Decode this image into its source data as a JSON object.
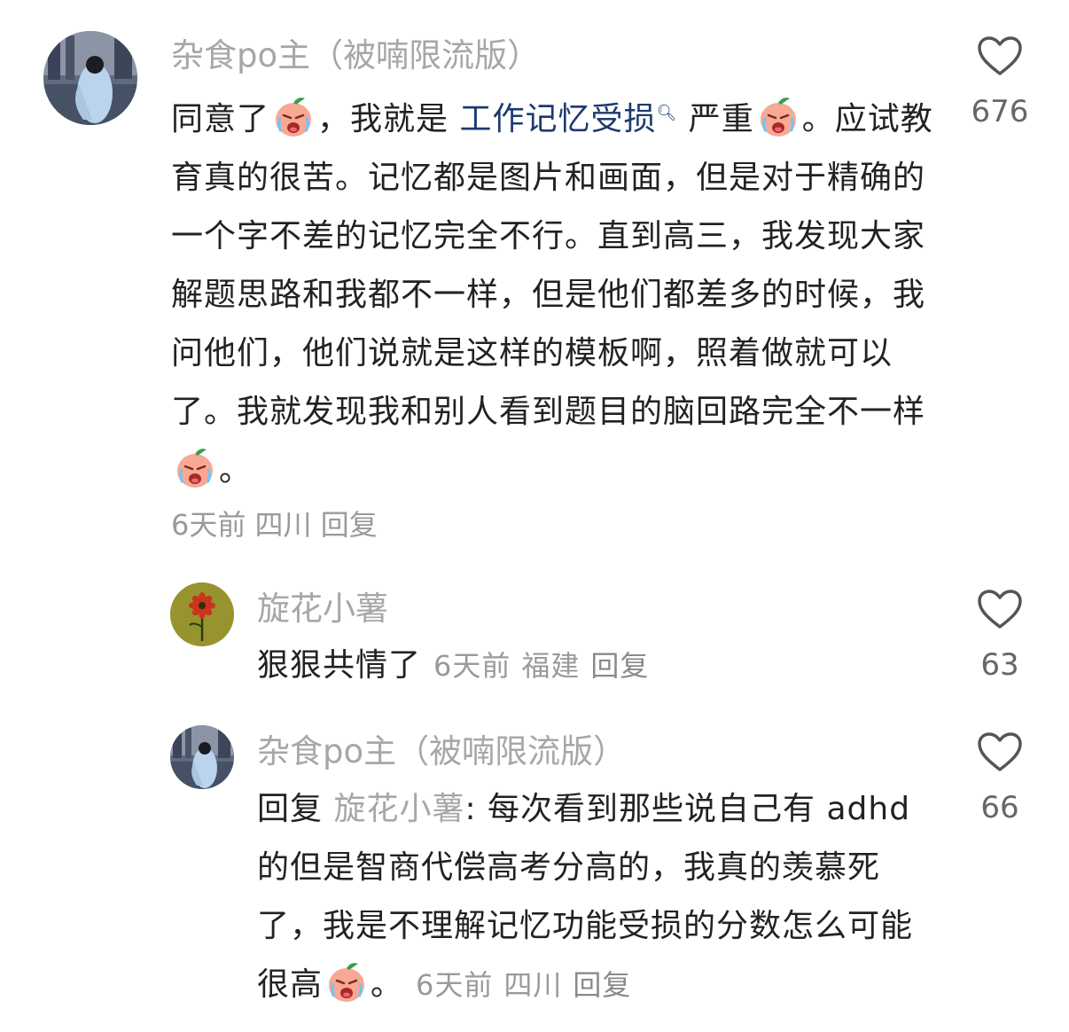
{
  "comments": [
    {
      "username": "杂食po主（被喃限流版）",
      "text_before_link": "同意了",
      "text_mid": "，我就是 ",
      "link": "工作记忆受损",
      "text_after_link": " 严重",
      "text_rest": "。应试教育真的很苦。记忆都是图片和画面，但是对于精确的一个字不差的记忆完全不行。直到高三，我发现大家解题思路和我都不一样，但是他们都差多的时候，我问他们，他们说就是这样的模板啊，照着做就可以了。我就发现我和别人看到题目的脑回路完全不一样",
      "text_end": "。",
      "time": "6天前",
      "location": "四川",
      "reply_label": "回复",
      "likes": "676",
      "emoji": "crying-face-emoji"
    },
    {
      "username": "旋花小薯",
      "text": "狠狠共情了",
      "time": "6天前",
      "location": "福建",
      "reply_label": "回复",
      "likes": "63"
    },
    {
      "username": "杂食po主（被喃限流版）",
      "reply_prefix": "回复 ",
      "reply_to": "旋花小薯",
      "reply_colon": ": ",
      "text": "每次看到那些说自己有 adhd的但是智商代偿高考分高的，我真的羡慕死了，我是不理解记忆功能受损的分数怎么可能很高",
      "text_end": "。",
      "time": "6天前",
      "location": "四川",
      "reply_label": "回复",
      "likes": "66"
    }
  ],
  "colors": {
    "username": "#a7a7a7",
    "body": "#222222",
    "link": "#1d3a6e",
    "meta": "#9a9a9a"
  },
  "icons": {
    "like": "heart-outline-icon",
    "emoji": "crying-peach-emoji"
  }
}
